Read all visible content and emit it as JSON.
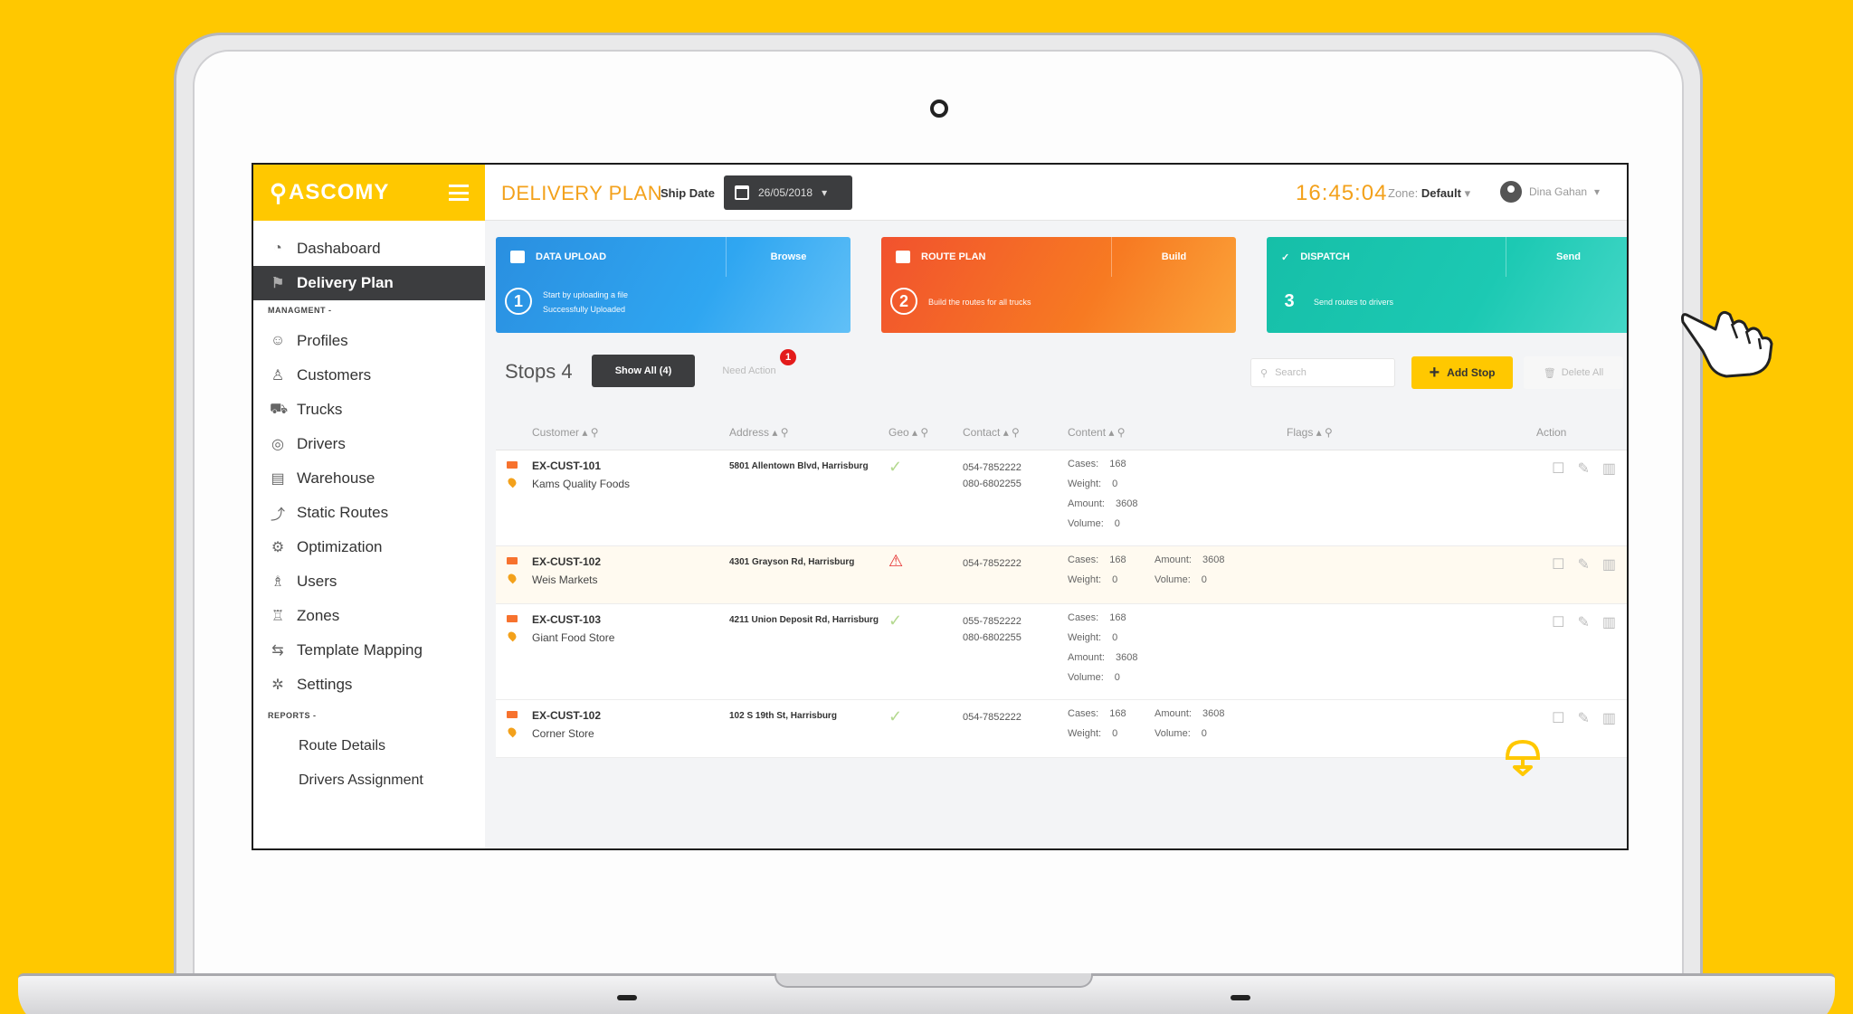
{
  "app": {
    "logo_mark": "⚲",
    "logo_text": "ASCOMY",
    "page_title": "DELIVERY PLAN",
    "ship_date_label": "Ship Date",
    "ship_date_value": "26/05/2018",
    "clock": "16:45:04",
    "zone_label": "Zone:",
    "zone_value": "Default",
    "user_name": "Dina Gahan"
  },
  "sidebar": {
    "dashboard": "Dashaboard",
    "delivery_plan": "Delivery Plan",
    "management_label": "MANAGMENT -",
    "items": [
      "Profiles",
      "Customers",
      "Trucks",
      "Drivers",
      "Warehouse",
      "Static Routes",
      "Optimization",
      "Users",
      "Zones",
      "Template Mapping",
      "Settings"
    ],
    "reports_label": "REPORTS -",
    "reports": [
      "Route Details",
      "Drivers Assignment"
    ]
  },
  "cards": [
    {
      "title": "DATA UPLOAD",
      "action": "Browse",
      "number": "1",
      "line1": "Start by uploading a file",
      "line2": "Successfully Uploaded"
    },
    {
      "title": "ROUTE PLAN",
      "action": "Build",
      "number": "2",
      "line1": "Build the routes for all trucks",
      "line2": ""
    },
    {
      "title": "DISPATCH",
      "action": "Send",
      "number": "3",
      "line1": "Send routes to drivers",
      "line2": ""
    }
  ],
  "toolbar": {
    "stops_title": "Stops 4",
    "show_all": "Show All (4)",
    "need_action": "Need Action",
    "badge": "1",
    "search_placeholder": "Search",
    "add_stop": "Add Stop",
    "delete_all": "Delete All"
  },
  "table": {
    "headers": [
      "Customer",
      "Address",
      "Geo",
      "Contact",
      "Content",
      "Flags",
      "Action"
    ],
    "rows": [
      {
        "id": "EX-CUST-101",
        "name": "Kams Quality Foods",
        "address": "5801 Allentown Blvd, Harrisburg",
        "geo": "ok",
        "contact1": "054-7852222",
        "contact2": "080-6802255",
        "cases": "168",
        "weight": "0",
        "amount": "3608",
        "volume": "0"
      },
      {
        "id": "EX-CUST-102",
        "name": "Weis Markets",
        "address": "4301 Grayson Rd, Harrisburg",
        "geo": "warn",
        "contact1": "054-7852222",
        "contact2": "",
        "cases": "168",
        "weight": "0",
        "amount": "3608",
        "volume": "0"
      },
      {
        "id": "EX-CUST-103",
        "name": "Giant Food Store",
        "address": "4211 Union Deposit Rd, Harrisburg",
        "geo": "ok",
        "contact1": "055-7852222",
        "contact2": "080-6802255",
        "cases": "168",
        "weight": "0",
        "amount": "3608",
        "volume": "0"
      },
      {
        "id": "EX-CUST-102",
        "name": "Corner Store",
        "address": "102 S 19th St, Harrisburg",
        "geo": "ok",
        "contact1": "054-7852222",
        "contact2": "",
        "cases": "168",
        "weight": "0",
        "amount": "3608",
        "volume": "0"
      }
    ],
    "labels": {
      "cases": "Cases:",
      "weight": "Weight:",
      "amount": "Amount:",
      "volume": "Volume:"
    }
  },
  "colors": {
    "brand_yellow": "#FFC800",
    "accent_orange": "#F3A11B",
    "dark": "#3C3D3F",
    "blue": "#2A8FE0",
    "red": "#F1522E",
    "teal": "#16BFA8"
  }
}
